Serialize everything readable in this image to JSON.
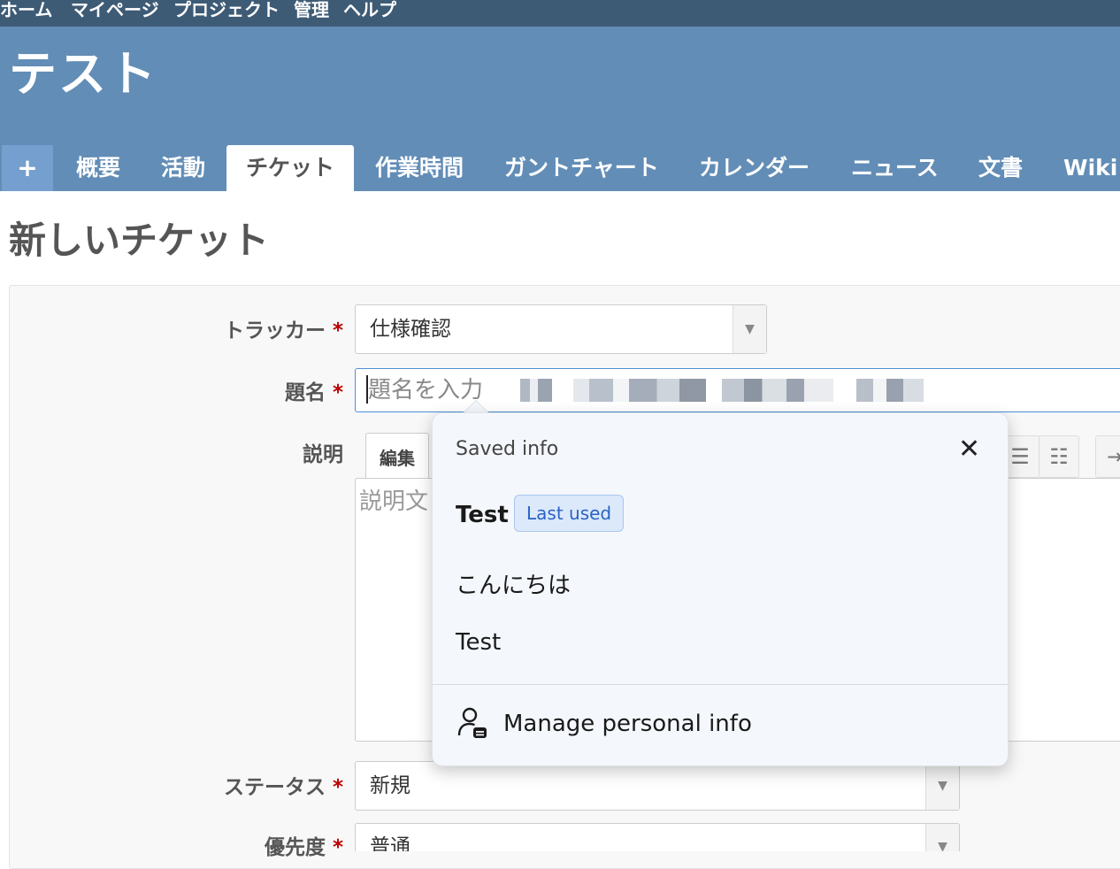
{
  "top_menu": {
    "items": [
      "ホーム",
      "マイページ",
      "プロジェクト",
      "管理",
      "ヘルプ"
    ]
  },
  "header": {
    "project_title": "テスト",
    "tabs": {
      "plus": "+",
      "overview": "概要",
      "activity": "活動",
      "issues": "チケット",
      "time": "作業時間",
      "gantt": "ガントチャート",
      "calendar": "カレンダー",
      "news": "ニュース",
      "documents": "文書",
      "wiki": "Wiki"
    },
    "active_tab": "チケット"
  },
  "page": {
    "heading": "新しいチケット"
  },
  "form": {
    "required_mark": "*",
    "tracker": {
      "label": "トラッカー",
      "value": "仕様確認"
    },
    "subject": {
      "label": "題名",
      "placeholder": "題名を入力"
    },
    "description": {
      "label": "説明",
      "edit_tab": "編集",
      "placeholder": "説明文"
    },
    "status": {
      "label": "ステータス",
      "value": "新規"
    },
    "priority": {
      "label": "優先度",
      "value": "普通"
    }
  },
  "autofill_popup": {
    "title": "Saved info",
    "suggestions": [
      {
        "text": "Test",
        "badge": "Last used"
      },
      {
        "text": "こんにちは"
      },
      {
        "text": "Test"
      }
    ],
    "manage_label": "Manage personal info"
  },
  "colors": {
    "top_menu_bg": "#3e5b76",
    "header_bg": "#628db6",
    "required": "#bb0000",
    "focus_border": "#4d90d6",
    "badge_text": "#2a63c4"
  }
}
